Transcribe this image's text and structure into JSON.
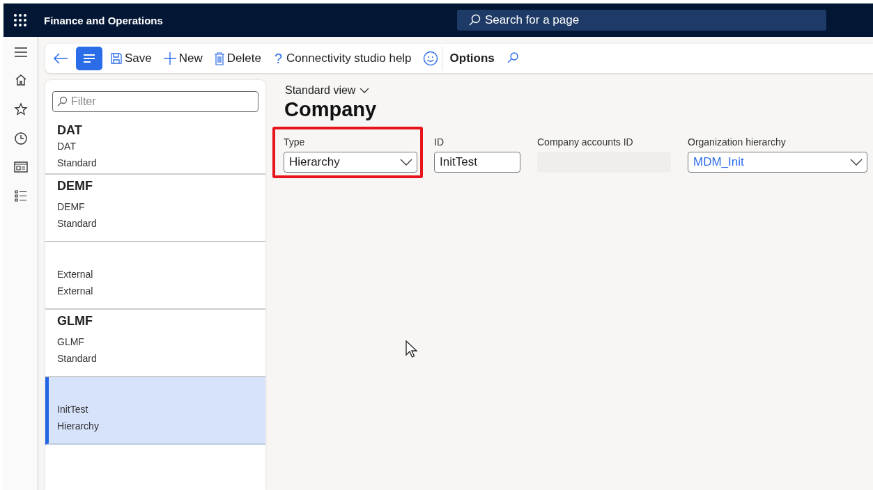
{
  "app": {
    "title": "Finance and Operations",
    "search_placeholder": "Search for a page"
  },
  "toolbar": [
    {
      "kind": "back"
    },
    {
      "kind": "list-toggle",
      "selected": true
    },
    {
      "kind": "save",
      "label": "Save"
    },
    {
      "kind": "new",
      "label": "New"
    },
    {
      "kind": "delete",
      "label": "Delete"
    },
    {
      "kind": "help",
      "icon": "?",
      "label": "Connectivity studio help"
    },
    {
      "kind": "smiley"
    },
    {
      "kind": "options",
      "label": "Options"
    },
    {
      "kind": "search"
    }
  ],
  "filter": {
    "placeholder": "Filter"
  },
  "list": [
    {
      "title": "DAT",
      "line_1": "DAT",
      "line_2": "Standard",
      "selected": false
    },
    {
      "title": "DEMF",
      "line_1": "DEMF",
      "line_2": "Standard",
      "selected": false
    },
    {
      "line_1": "External",
      "line_2": "External",
      "selected": false
    },
    {
      "title": "GLMF",
      "line_1": "GLMF",
      "line_2": "Standard",
      "selected": false
    },
    {
      "line_1": "InitTest",
      "line_2": "Hierarchy",
      "selected": true
    }
  ],
  "view": {
    "label": "Standard view"
  },
  "page_title": "Company",
  "fields": [
    {
      "label": "Type",
      "kind": "select",
      "value": "Hierarchy",
      "highlighted": true
    },
    {
      "label": "ID",
      "kind": "text",
      "value": "InitTest",
      "highlighted": false
    },
    {
      "label": "Company accounts ID",
      "kind": "readonly",
      "highlighted": false
    },
    {
      "label": "Organization hierarchy",
      "kind": "link-select",
      "value": "MDM_Init",
      "highlighted": false
    }
  ]
}
